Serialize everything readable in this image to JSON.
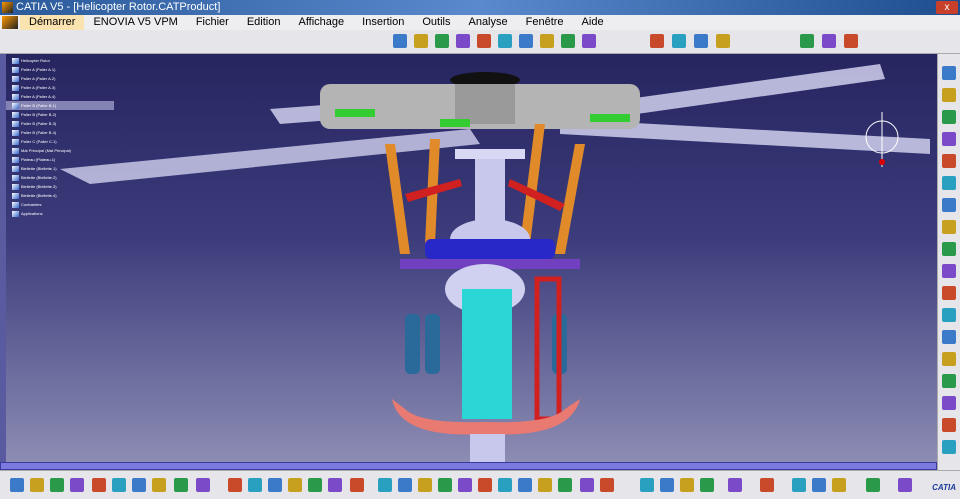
{
  "window": {
    "title": "CATIA V5 - [Helicopter Rotor.CATProduct]",
    "close": "x"
  },
  "menu": [
    "Démarrer",
    "ENOVIA V5 VPM",
    "Fichier",
    "Edition",
    "Affichage",
    "Insertion",
    "Outils",
    "Analyse",
    "Fenêtre",
    "Aide"
  ],
  "tree": {
    "items": [
      "Helicopter Rotor",
      "Palier A (Palier A.1)",
      "Palier A (Palier A.2)",
      "Palier A (Palier A.3)",
      "Palier A (Palier A.4)",
      "Palier B (Palier B.1)",
      "Palier B (Palier B.2)",
      "Palier B (Palier B.3)",
      "Palier B (Palier B.4)",
      "Palier C (Palier C.1)",
      "Mat Principal (Mat Principal)",
      "Plateau (Plateau.1)",
      "Biellette (Biellette.1)",
      "Biellette (Biellette.2)",
      "Biellette (Biellette.3)",
      "Biellette (Biellette.4)",
      "Contraintes",
      "Applications"
    ]
  },
  "colors": {
    "viewport_top": "#262560",
    "viewport_bottom": "#8c8cb4",
    "menu_active": "#fbe3b0"
  },
  "icons": {
    "bottom_logo": "CATIA"
  }
}
